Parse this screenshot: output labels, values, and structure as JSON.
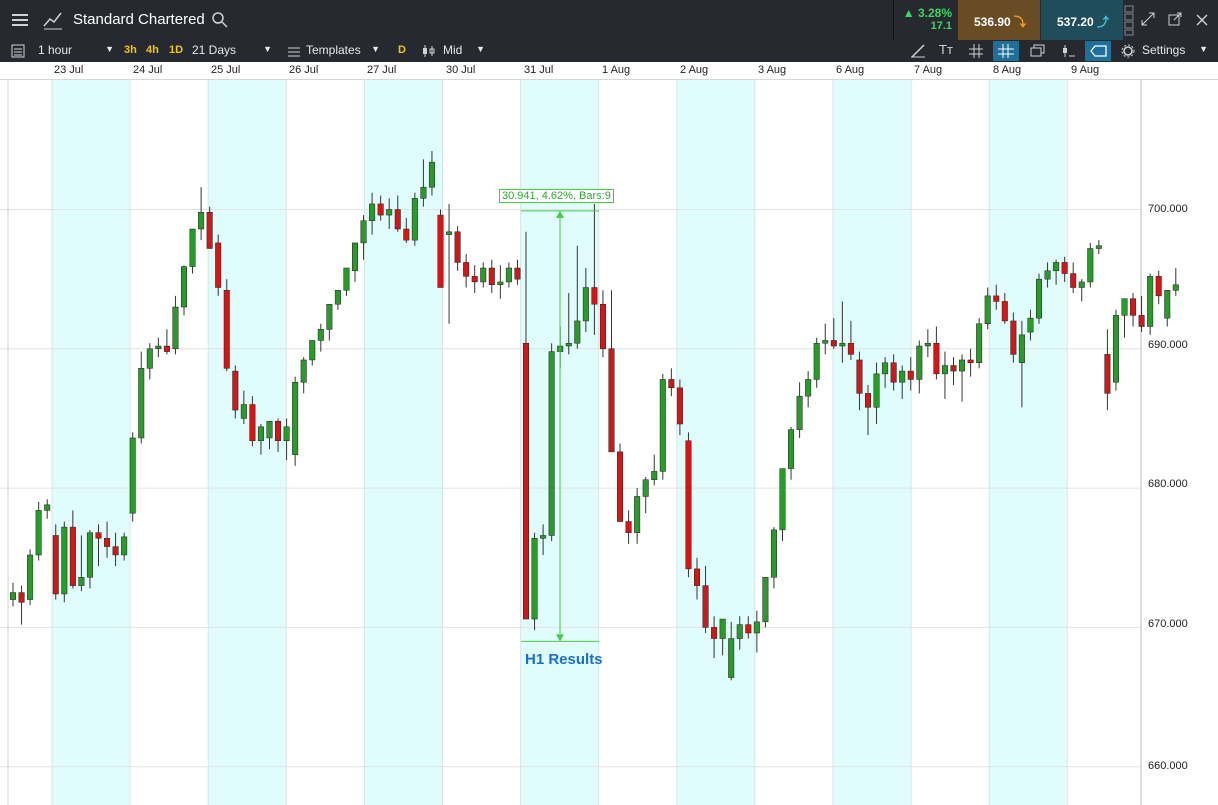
{
  "header": {
    "instrument": "Standard Chartered",
    "change_pct": "3.28%",
    "change_abs": "17.1",
    "sell_price": "536.90",
    "buy_price": "537.20"
  },
  "toolbar": {
    "interval": "1 hour",
    "quick": [
      "3h",
      "4h",
      "1D"
    ],
    "range": "21 Days",
    "templates": "Templates",
    "d_badge": "D",
    "price_type": "Mid",
    "settings": "Settings"
  },
  "colors": {
    "up": "#2a9a2a",
    "down": "#d01818",
    "shade": "#e0fcfc",
    "measure": "#44cc44",
    "annotation": "#1a6fd0"
  },
  "chart_data": {
    "type": "candlestick",
    "x_labels": [
      "23 Jul",
      "24 Jul",
      "25 Jul",
      "26 Jul",
      "27 Jul",
      "30 Jul",
      "31 Jul",
      "1 Aug",
      "2 Aug",
      "3 Aug",
      "6 Aug",
      "7 Aug",
      "8 Aug",
      "9 Aug"
    ],
    "y_ticks": [
      "700.000",
      "690.000",
      "680.000",
      "670.000",
      "660.000"
    ],
    "ylim": [
      655,
      705
    ],
    "measure_label": "30.941, 4.62%, Bars:9",
    "annotation": "H1 Results",
    "candles": [
      [
        672.0,
        673.2,
        671.5,
        672.5
      ],
      [
        672.5,
        673.0,
        670.2,
        671.8
      ],
      [
        672.0,
        675.6,
        671.6,
        675.2
      ],
      [
        675.2,
        679.0,
        674.8,
        678.4
      ],
      [
        678.4,
        679.2,
        677.8,
        678.8
      ],
      [
        676.6,
        677.4,
        672.0,
        672.4
      ],
      [
        672.4,
        677.6,
        671.8,
        677.2
      ],
      [
        677.2,
        678.4,
        672.8,
        673.0
      ],
      [
        673.0,
        676.6,
        672.6,
        673.6
      ],
      [
        673.6,
        677.0,
        672.8,
        676.8
      ],
      [
        676.8,
        677.4,
        674.4,
        676.4
      ],
      [
        676.4,
        677.6,
        675.0,
        675.8
      ],
      [
        675.8,
        676.8,
        674.4,
        675.2
      ],
      [
        675.2,
        676.8,
        674.8,
        676.5
      ],
      [
        678.2,
        684.0,
        677.6,
        683.6
      ],
      [
        683.6,
        689.8,
        683.2,
        688.6
      ],
      [
        688.6,
        690.4,
        687.8,
        690.0
      ],
      [
        690.0,
        690.8,
        689.4,
        690.2
      ],
      [
        690.2,
        691.4,
        689.6,
        689.8
      ],
      [
        690.0,
        693.8,
        689.6,
        693.0
      ],
      [
        693.0,
        696.0,
        692.4,
        695.9
      ],
      [
        695.9,
        698.6,
        695.4,
        698.6
      ],
      [
        698.6,
        701.6,
        697.8,
        699.8
      ],
      [
        699.8,
        700.2,
        697.6,
        697.2
      ],
      [
        697.6,
        698.2,
        693.8,
        694.4
      ],
      [
        694.2,
        695.0,
        688.4,
        688.6
      ],
      [
        688.4,
        688.8,
        685.0,
        685.6
      ],
      [
        685.0,
        687.0,
        684.6,
        686.0
      ],
      [
        686.0,
        686.6,
        683.0,
        683.4
      ],
      [
        683.4,
        684.6,
        682.4,
        684.4
      ],
      [
        683.6,
        684.8,
        682.8,
        684.8
      ],
      [
        684.8,
        685.0,
        682.6,
        683.4
      ],
      [
        683.4,
        685.0,
        682.0,
        684.4
      ],
      [
        682.4,
        688.0,
        681.6,
        687.6
      ],
      [
        687.6,
        689.4,
        686.8,
        689.2
      ],
      [
        689.2,
        690.6,
        688.8,
        690.6
      ],
      [
        690.6,
        691.8,
        689.8,
        691.4
      ],
      [
        691.4,
        693.0,
        690.6,
        693.2
      ],
      [
        693.2,
        694.2,
        692.8,
        694.2
      ],
      [
        694.2,
        695.2,
        693.8,
        695.8
      ],
      [
        695.6,
        697.4,
        694.8,
        697.6
      ],
      [
        697.6,
        699.6,
        696.4,
        699.2
      ],
      [
        699.2,
        701.2,
        698.2,
        700.4
      ],
      [
        700.4,
        701.0,
        699.2,
        699.6
      ],
      [
        699.6,
        700.8,
        698.6,
        700.0
      ],
      [
        700.0,
        701.0,
        698.4,
        698.6
      ],
      [
        698.6,
        699.4,
        697.6,
        697.8
      ],
      [
        697.8,
        701.2,
        697.4,
        700.8
      ],
      [
        700.8,
        703.6,
        700.2,
        701.6
      ],
      [
        701.6,
        704.2,
        701.0,
        703.4
      ],
      [
        699.6,
        700.0,
        694.8,
        694.4
      ],
      [
        698.2,
        700.4,
        691.8,
        698.4
      ],
      [
        698.4,
        698.8,
        695.6,
        696.2
      ],
      [
        696.2,
        696.8,
        694.4,
        695.2
      ],
      [
        695.2,
        696.0,
        694.0,
        694.8
      ],
      [
        694.8,
        696.2,
        694.4,
        695.8
      ],
      [
        695.8,
        696.4,
        694.0,
        694.6
      ],
      [
        694.6,
        696.0,
        693.6,
        694.8
      ],
      [
        694.8,
        696.2,
        694.4,
        695.8
      ],
      [
        695.8,
        696.4,
        694.6,
        695.0
      ],
      [
        690.4,
        698.4,
        670.6,
        670.6
      ],
      [
        670.6,
        676.8,
        669.8,
        676.4
      ],
      [
        676.4,
        677.4,
        675.2,
        676.6
      ],
      [
        676.6,
        690.4,
        676.2,
        689.8
      ],
      [
        689.8,
        691.6,
        688.6,
        690.2
      ],
      [
        690.2,
        694.0,
        689.6,
        690.4
      ],
      [
        690.4,
        697.4,
        690.0,
        692.0
      ],
      [
        692.0,
        695.8,
        691.2,
        694.4
      ],
      [
        694.4,
        700.4,
        691.0,
        693.2
      ],
      [
        693.2,
        694.2,
        689.4,
        690.0
      ],
      [
        690.0,
        694.2,
        688.8,
        682.6
      ],
      [
        682.6,
        683.2,
        678.4,
        677.6
      ],
      [
        677.6,
        678.4,
        676.0,
        676.8
      ],
      [
        676.8,
        680.0,
        676.0,
        679.4
      ],
      [
        679.4,
        680.8,
        678.2,
        680.6
      ],
      [
        680.6,
        682.4,
        680.2,
        681.2
      ],
      [
        681.2,
        688.2,
        680.6,
        687.8
      ],
      [
        687.8,
        688.6,
        686.6,
        687.2
      ],
      [
        687.2,
        687.8,
        683.8,
        684.6
      ],
      [
        683.4,
        684.0,
        673.6,
        674.2
      ],
      [
        674.2,
        675.0,
        672.0,
        673.0
      ],
      [
        673.0,
        674.4,
        669.6,
        670.0
      ],
      [
        670.0,
        670.8,
        667.8,
        669.2
      ],
      [
        669.2,
        670.0,
        668.0,
        670.6
      ],
      [
        666.4,
        670.4,
        666.2,
        669.2
      ],
      [
        669.2,
        670.8,
        668.4,
        670.2
      ],
      [
        670.2,
        670.8,
        669.2,
        669.6
      ],
      [
        669.6,
        671.2,
        668.2,
        670.4
      ],
      [
        670.4,
        673.6,
        670.0,
        673.6
      ],
      [
        673.6,
        677.2,
        672.8,
        677.0
      ],
      [
        677.0,
        681.0,
        676.2,
        681.4
      ],
      [
        681.4,
        684.4,
        680.6,
        684.2
      ],
      [
        684.2,
        687.6,
        683.6,
        686.6
      ],
      [
        686.6,
        688.4,
        685.8,
        687.8
      ],
      [
        687.8,
        690.8,
        687.2,
        690.4
      ],
      [
        690.4,
        691.8,
        689.6,
        690.6
      ],
      [
        690.6,
        692.2,
        690.0,
        690.2
      ],
      [
        690.2,
        693.4,
        689.0,
        690.4
      ],
      [
        690.4,
        692.0,
        689.2,
        689.6
      ],
      [
        689.2,
        689.8,
        685.6,
        686.8
      ],
      [
        686.8,
        687.4,
        683.8,
        685.8
      ],
      [
        685.8,
        689.0,
        684.6,
        688.2
      ],
      [
        688.2,
        689.4,
        687.2,
        689.0
      ],
      [
        689.0,
        689.6,
        687.0,
        687.6
      ],
      [
        687.6,
        688.8,
        686.4,
        688.4
      ],
      [
        688.4,
        689.4,
        687.0,
        687.8
      ],
      [
        687.8,
        690.6,
        686.8,
        690.2
      ],
      [
        690.2,
        691.4,
        689.4,
        690.4
      ],
      [
        690.4,
        691.6,
        687.8,
        688.2
      ],
      [
        688.2,
        689.8,
        686.4,
        688.8
      ],
      [
        688.8,
        689.4,
        687.4,
        688.4
      ],
      [
        688.4,
        689.6,
        686.2,
        689.2
      ],
      [
        689.2,
        690.0,
        688.0,
        689.0
      ],
      [
        689.0,
        692.2,
        688.6,
        691.8
      ],
      [
        691.8,
        694.4,
        691.4,
        693.8
      ],
      [
        693.8,
        694.6,
        692.8,
        693.4
      ],
      [
        693.4,
        694.0,
        691.8,
        692.0
      ],
      [
        692.0,
        692.6,
        689.0,
        689.6
      ],
      [
        689.0,
        692.0,
        685.8,
        691.0
      ],
      [
        691.2,
        692.8,
        690.6,
        692.2
      ],
      [
        692.2,
        695.4,
        691.8,
        695.0
      ],
      [
        695.0,
        696.2,
        694.4,
        695.6
      ],
      [
        695.6,
        696.4,
        694.6,
        696.2
      ],
      [
        696.2,
        696.6,
        694.8,
        695.4
      ],
      [
        695.4,
        696.2,
        694.0,
        694.4
      ],
      [
        694.4,
        695.0,
        693.4,
        694.8
      ],
      [
        694.8,
        697.6,
        694.4,
        697.2
      ],
      [
        697.2,
        697.8,
        696.8,
        697.4
      ],
      [
        689.6,
        691.4,
        685.6,
        686.8
      ],
      [
        687.6,
        692.8,
        687.0,
        692.4
      ],
      [
        692.4,
        693.2,
        690.8,
        693.6
      ],
      [
        693.6,
        694.0,
        691.6,
        692.4
      ],
      [
        692.4,
        693.8,
        691.2,
        691.6
      ],
      [
        691.6,
        695.4,
        691.0,
        695.2
      ],
      [
        695.2,
        695.6,
        693.2,
        693.8
      ],
      [
        692.2,
        694.0,
        691.6,
        694.2
      ],
      [
        694.2,
        695.8,
        693.8,
        694.6
      ]
    ]
  }
}
